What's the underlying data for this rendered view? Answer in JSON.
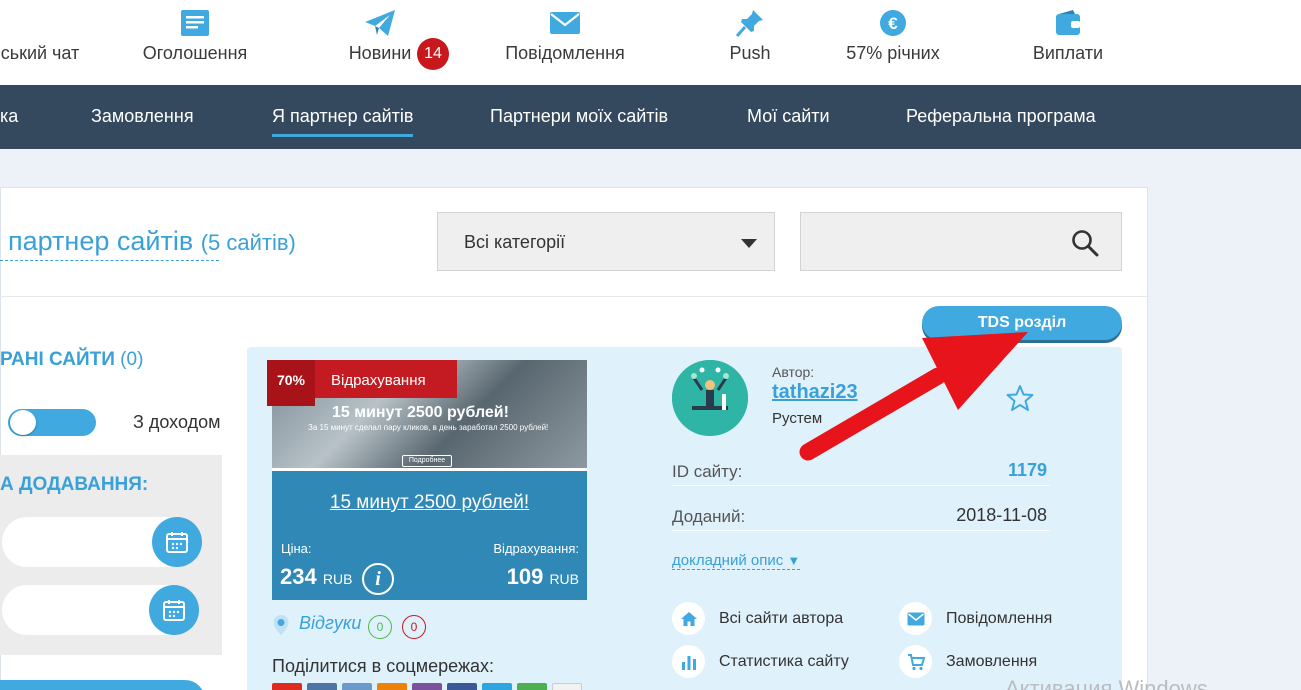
{
  "topnav": {
    "items": [
      {
        "label": "ський чат",
        "icon": "chat-icon"
      },
      {
        "label": "Оголошення",
        "icon": "notes-icon"
      },
      {
        "label": "Новини",
        "icon": "paper-plane-icon",
        "badge": "14"
      },
      {
        "label": "Повідомлення",
        "icon": "envelope-icon"
      },
      {
        "label": "Push",
        "icon": "pin-icon"
      },
      {
        "label": "57% річних",
        "icon": "euro-coins-icon"
      },
      {
        "label": "Виплати",
        "icon": "wallet-icon"
      }
    ]
  },
  "secnav": {
    "items": [
      {
        "label": "ка"
      },
      {
        "label": "Замовлення"
      },
      {
        "label": "Я партнер сайтів",
        "active": true
      },
      {
        "label": "Партнери моїх сайтів"
      },
      {
        "label": "Мої сайти"
      },
      {
        "label": "Реферальна програма"
      }
    ]
  },
  "page": {
    "title": "партнер сайтів",
    "count": "(5 сайтів)"
  },
  "filters": {
    "category_value": "Всі категорії",
    "search_value": "",
    "tds_button": "TDS розділ"
  },
  "sidebar": {
    "favorites_heading": "РАНІ САЙТИ",
    "favorites_count": "(0)",
    "toggle_label": "З доходом",
    "date_heading": "А ДОДАВАННЯ:",
    "date_from": "",
    "date_to": ""
  },
  "site": {
    "ribbon_percent": "70%",
    "ribbon_label": "Відрахування",
    "image_headline": "15 минут 2500 рублей!",
    "image_subline": "За 15 минут сделал пару кликов, в день заработал 2500 рублей!",
    "image_button": "Подробнее",
    "title_link": "15 минут 2500 рублей!",
    "price_label": "Ціна:",
    "price_value": "234",
    "price_currency": "RUB",
    "commission_label": "Відрахування:",
    "commission_value": "109",
    "commission_currency": "RUB",
    "reviews_label": "Відгуки",
    "reviews_positive": "0",
    "reviews_negative": "0",
    "share_label": "Поділитися в соцмережах:",
    "share_buttons": [
      {
        "name": "youtube-share",
        "color": "#e02a20"
      },
      {
        "name": "vk-share",
        "color": "#4c75a3"
      },
      {
        "name": "mail-share",
        "color": "#6a9ac9"
      },
      {
        "name": "ok-share",
        "color": "#ee8208"
      },
      {
        "name": "viber-share",
        "color": "#7b519d"
      },
      {
        "name": "facebook-share",
        "color": "#3b5998"
      },
      {
        "name": "telegram-share",
        "color": "#2ca5e0"
      },
      {
        "name": "whatsapp-share",
        "color": "#4caf50"
      },
      {
        "name": "more-share",
        "color": "#f2f2f2"
      }
    ]
  },
  "author": {
    "caption": "Автор:",
    "username": "tathazi23",
    "real_name": "Рустем"
  },
  "meta": {
    "id_label": "ID сайту:",
    "id_value": "1179",
    "added_label": "Доданий:",
    "added_value": "2018-11-08",
    "more_link": "докладний опис",
    "more_arrow": "▼"
  },
  "actions": [
    {
      "label": "Всі сайти автора",
      "icon": "home-icon"
    },
    {
      "label": "Повідомлення",
      "icon": "envelope-icon"
    },
    {
      "label": "Статистика сайту",
      "icon": "bar-chart-icon"
    },
    {
      "label": "Замовлення",
      "icon": "cart-icon"
    }
  ],
  "watermark": "Активация Windows",
  "colors": {
    "accent": "#3fa9e0",
    "nav_dark": "#34495e",
    "badge": "#c9171e",
    "ribbon": "#c41a21",
    "arrow": "#e8141b"
  }
}
